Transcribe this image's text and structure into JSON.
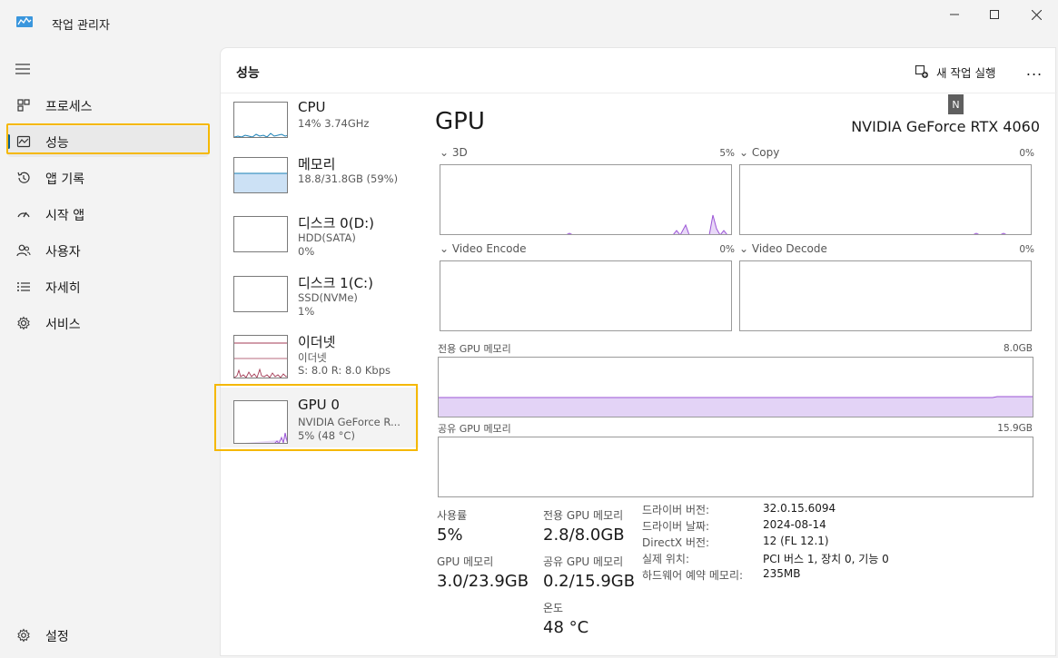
{
  "window": {
    "title": "작업 관리자"
  },
  "nav": {
    "items": [
      {
        "label": "프로세스",
        "icon": "processes-icon"
      },
      {
        "label": "성능",
        "icon": "performance-icon"
      },
      {
        "label": "앱 기록",
        "icon": "app-history-icon"
      },
      {
        "label": "시작 앱",
        "icon": "startup-apps-icon"
      },
      {
        "label": "사용자",
        "icon": "users-icon"
      },
      {
        "label": "자세히",
        "icon": "details-icon"
      },
      {
        "label": "서비스",
        "icon": "services-icon"
      }
    ],
    "settings": {
      "label": "설정",
      "icon": "gear-icon"
    }
  },
  "header": {
    "title": "성능",
    "run_task": "새 작업 실행",
    "more": "...",
    "tooltip": "N"
  },
  "devices": [
    {
      "name": "CPU",
      "sub1": "14% 3.74GHz",
      "sub2": ""
    },
    {
      "name": "메모리",
      "sub1": "18.8/31.8GB (59%)",
      "sub2": ""
    },
    {
      "name": "디스크 0(D:)",
      "sub1": "HDD(SATA)",
      "sub2": "0%"
    },
    {
      "name": "디스크 1(C:)",
      "sub1": "SSD(NVMe)",
      "sub2": "1%"
    },
    {
      "name": "이더넷",
      "sub1": "이더넷",
      "sub2": "S: 8.0  R: 8.0 Kbps"
    },
    {
      "name": "GPU 0",
      "sub1": "NVIDIA GeForce R...",
      "sub2": "5% (48 °C)"
    }
  ],
  "detail": {
    "title": "GPU",
    "model": "NVIDIA GeForce RTX 4060",
    "graphs": {
      "g3d": {
        "label": "3D",
        "pct": "5%"
      },
      "copy": {
        "label": "Copy",
        "pct": "0%"
      },
      "venc": {
        "label": "Video Encode",
        "pct": "0%"
      },
      "vdec": {
        "label": "Video Decode",
        "pct": "0%"
      },
      "dedicated": {
        "label": "전용 GPU 메모리",
        "max": "8.0GB"
      },
      "shared": {
        "label": "공유 GPU 메모리",
        "max": "15.9GB"
      }
    },
    "stats": {
      "utilization_label": "사용률",
      "utilization": "5%",
      "dedicated_label": "전용 GPU 메모리",
      "dedicated": "2.8/8.0GB",
      "gpu_mem_label": "GPU 메모리",
      "gpu_mem": "3.0/23.9GB",
      "shared_label": "공유 GPU 메모리",
      "shared": "0.2/15.9GB",
      "temp_label": "온도",
      "temp": "48 °C"
    },
    "info": [
      {
        "key": "드라이버 버전:",
        "value": "32.0.15.6094"
      },
      {
        "key": "드라이버 날짜:",
        "value": "2024-08-14"
      },
      {
        "key": "DirectX 버전:",
        "value": "12 (FL 12.1)"
      },
      {
        "key": "실제 위치:",
        "value": "PCI 버스 1, 장치 0, 기능 0"
      },
      {
        "key": "하드웨어 예약 메모리:",
        "value": "235MB"
      }
    ]
  },
  "colors": {
    "cpu": "#1a80b6",
    "memory": "#7fb2e5",
    "ethernet": "#a33a55",
    "gpu": "#9b55d6",
    "highlight": "#f5b800"
  }
}
